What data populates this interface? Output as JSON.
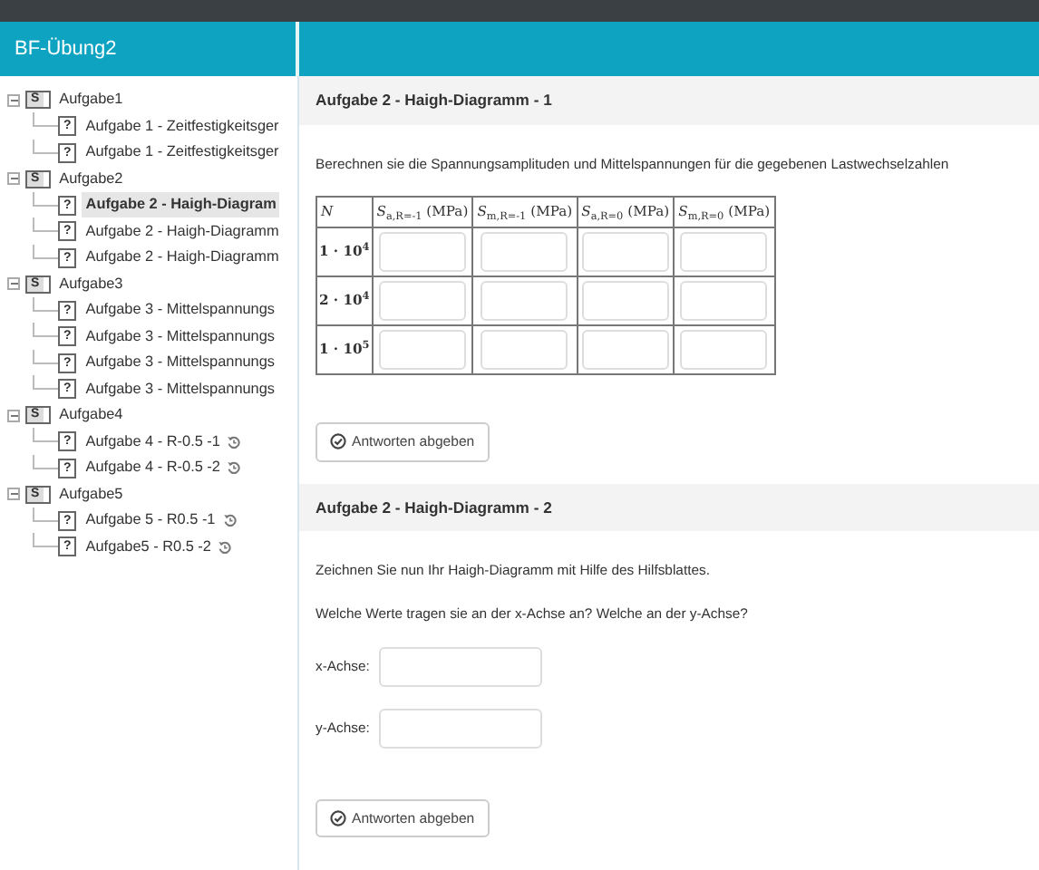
{
  "app_title": "BF-Übung2",
  "tree": [
    {
      "label": "Aufgabe1",
      "icon_label": "S",
      "expanded": true,
      "children": [
        {
          "label": "Aufgabe 1 - Zeitfestigkeitsger",
          "icon_label": "?",
          "selected": false,
          "kind": "plain"
        },
        {
          "label": "Aufgabe 1 - Zeitfestigkeitsger",
          "icon_label": "?",
          "selected": false,
          "kind": "plain"
        }
      ]
    },
    {
      "label": "Aufgabe2",
      "icon_label": "S",
      "expanded": true,
      "children": [
        {
          "label": "Aufgabe 2 - Haigh-Diagram",
          "icon_label": "?",
          "selected": true,
          "kind": "plain"
        },
        {
          "label": "Aufgabe 2 - Haigh-Diagramm",
          "icon_label": "?",
          "selected": false,
          "kind": "plain"
        },
        {
          "label": "Aufgabe 2 - Haigh-Diagramm",
          "icon_label": "?",
          "selected": false,
          "kind": "plain"
        }
      ]
    },
    {
      "label": "Aufgabe3",
      "icon_label": "S",
      "expanded": true,
      "children": [
        {
          "label": "Aufgabe 3 - Mittelspannungs",
          "icon_label": "?",
          "selected": false,
          "kind": "plain"
        },
        {
          "label": "Aufgabe 3 - Mittelspannungs",
          "icon_label": "?",
          "selected": false,
          "kind": "plain"
        },
        {
          "label": "Aufgabe 3 - Mittelspannungs",
          "icon_label": "?",
          "selected": false,
          "kind": "plain"
        },
        {
          "label": "Aufgabe 3 - Mittelspannungs",
          "icon_label": "?",
          "selected": false,
          "kind": "plain"
        }
      ]
    },
    {
      "label": "Aufgabe4",
      "icon_label": "S",
      "expanded": true,
      "children": [
        {
          "label": "Aufgabe 4 - R-0.5 -1",
          "icon_label": "?",
          "selected": false,
          "kind": "retry"
        },
        {
          "label": "Aufgabe 4 - R-0.5 -2",
          "icon_label": "?",
          "selected": false,
          "kind": "retry"
        }
      ]
    },
    {
      "label": "Aufgabe5",
      "icon_label": "S",
      "expanded": true,
      "children": [
        {
          "label": "Aufgabe 5 - R0.5 -1",
          "icon_label": "?",
          "selected": false,
          "kind": "retry"
        },
        {
          "label": "Aufgabe5 - R0.5 -2",
          "icon_label": "?",
          "selected": false,
          "kind": "retry"
        }
      ]
    }
  ],
  "sections": [
    {
      "title": "Aufgabe 2 - Haigh-Diagramm - 1",
      "paragraphs": [
        "Berechnen sie die Spannungsamplituden und Mittelspannungen für die gegebenen Lastwechselzahlen"
      ],
      "table": {
        "columns": [
          "*N*",
          "*S*$_{a,R=-1}$ (MPa)",
          "*S*$_{m,R=-1}$ (MPa)",
          "*S*$_{a,R=0}$ (MPa)",
          "*S*$_{m,R=0}$ (MPa)"
        ],
        "rows": [
          "1 · 10$^{4}$",
          "2 · 10$^{4}$",
          "1 · 10$^{5}$"
        ]
      },
      "button": "Antworten abgeben"
    },
    {
      "title": "Aufgabe 2 - Haigh-Diagramm - 2",
      "paragraphs": [
        "Zeichnen Sie nun Ihr Haigh-Diagramm mit Hilfe des Hilfsblattes.",
        "Welche Werte tragen sie an der x-Achse an? Welche an der y-Achse?"
      ],
      "fields": [
        {
          "label": "x-Achse:"
        },
        {
          "label": "y-Achse:"
        }
      ],
      "button": "Antworten abgeben"
    }
  ]
}
